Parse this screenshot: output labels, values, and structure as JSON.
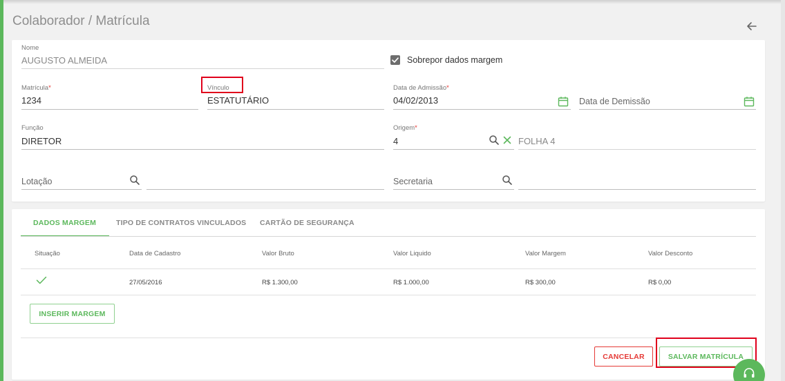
{
  "page": {
    "title": "Colaborador / Matrícula"
  },
  "colors": {
    "accent": "#5cb85c",
    "danger": "#e53935",
    "highlight": "#e0001b"
  },
  "form": {
    "nome": {
      "label": "Nome",
      "value": "AUGUSTO ALMEIDA"
    },
    "sobrepor": {
      "label": "Sobrepor dados margem",
      "checked": true
    },
    "matricula": {
      "label": "Matrícula",
      "required_mark": "*",
      "value": "1234"
    },
    "vinculo": {
      "label": "Vínculo",
      "value": "ESTATUTÁRIO"
    },
    "data_admissao": {
      "label": "Data de Admissão",
      "required_mark": "*",
      "value": "04/02/2013"
    },
    "data_demissao": {
      "placeholder": "Data de Demissão"
    },
    "funcao": {
      "label": "Função",
      "value": "DIRETOR"
    },
    "origem": {
      "label": "Origem",
      "required_mark": "*",
      "value": "4",
      "description": "FOLHA 4"
    },
    "lotacao": {
      "placeholder": "Lotação"
    },
    "secretaria": {
      "placeholder": "Secretaria"
    }
  },
  "tabs": [
    {
      "label": "DADOS MARGEM",
      "active": true
    },
    {
      "label": "TIPO DE CONTRATOS VINCULADOS",
      "active": false
    },
    {
      "label": "CARTÃO DE SEGURANÇA",
      "active": false
    }
  ],
  "table": {
    "headers": [
      "Situação",
      "Data de Cadastro",
      "Valor Bruto",
      "Valor Liquido",
      "Valor Margem",
      "Valor Desconto"
    ],
    "rows": [
      {
        "situacao_icon": "check-icon",
        "data_cadastro": "27/05/2016",
        "valor_bruto": "R$ 1.300,00",
        "valor_liquido": "R$ 1.000,00",
        "valor_margem": "R$ 300,00",
        "valor_desconto": "R$ 0,00"
      }
    ]
  },
  "buttons": {
    "inserir_margem": "INSERIR MARGEM",
    "cancelar": "CANCELAR",
    "salvar": "SALVAR MATRÍCULA"
  },
  "icons": {
    "back": "arrow-left-icon",
    "calendar": "calendar-icon",
    "search": "search-icon",
    "clear": "close-icon",
    "support": "headset-icon"
  }
}
